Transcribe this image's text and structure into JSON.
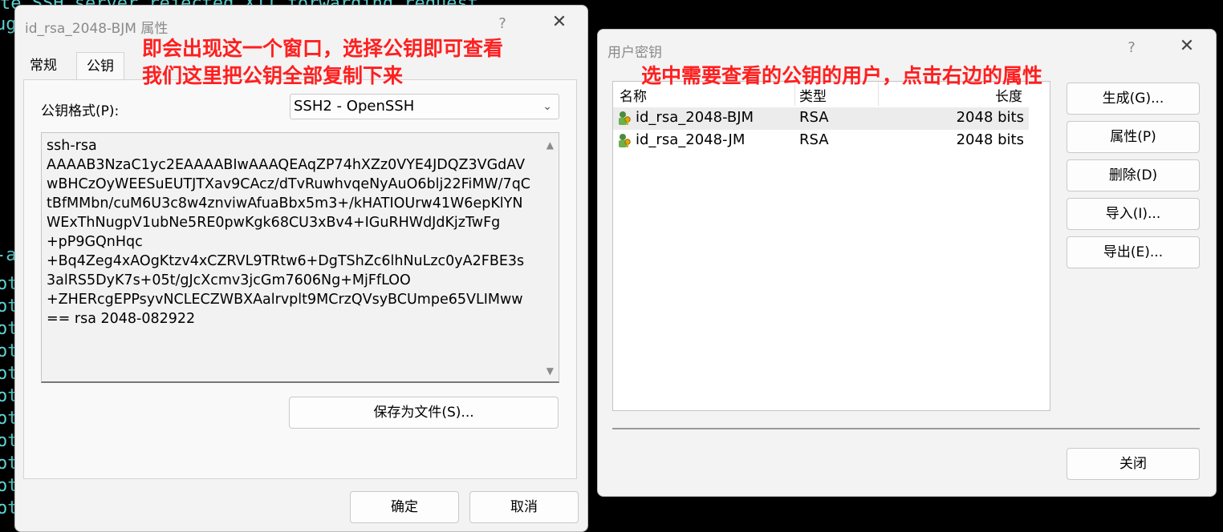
{
  "terminal": {
    "top_line": "te SSH server rejected X11 forwarding request.",
    "ug": "ug",
    "dash_a": "-a",
    "ot": "ot"
  },
  "props_dialog": {
    "title": "id_rsa_2048-BJM 属性",
    "help": "?",
    "close": "✕",
    "tabs": [
      "常规",
      "公钥"
    ],
    "format_label": "公钥格式(P):",
    "format_value": "SSH2 - OpenSSH",
    "key_text": "ssh-rsa\nAAAAB3NzaC1yc2EAAAABIwAAAQEAqZP74hXZz0VYE4JDQZ3VGdAVwBHCzOyWEESuEUTJTXav9CAcz/dTvRuwhvqeNyAuO6blj22FiMW/7qCtBfMMbn/cuM6U3c8w4znviwAfuaBbx5m3+/kHATIOUrw41W6epKlYNWExThNugpV1ubNe5RE0pwKgk68CU3xBv4+IGuRHWdJdKjzTwFg\n+pP9GQnHqc\n+Bq4Zeg4xAOgKtzv4xCZRVL9TRtw6+DgTShZc6lhNuLzc0yA2FBE3s3alRS5DyK7s+05t/gJcXcmv3jcGm7606Ng+MjFfLOO\n+ZHERcgEPPsyvNCLECZWBXAalrvplt9MCrzQVsyBCUmpe65VLIMww== rsa 2048-082922",
    "save_button": "保存为文件(S)...",
    "ok_button": "确定",
    "cancel_button": "取消",
    "annotation_line1": "即会出现这一个窗口，选择公钥即可查看",
    "annotation_line2": "我们这里把公钥全部复制下来"
  },
  "keys_dialog": {
    "title": "用户密钥",
    "help": "?",
    "close": "✕",
    "columns": [
      "名称",
      "类型",
      "长度"
    ],
    "rows": [
      {
        "name": "id_rsa_2048-BJM",
        "type": "RSA",
        "length": "2048 bits",
        "selected": true
      },
      {
        "name": "id_rsa_2048-JM",
        "type": "RSA",
        "length": "2048 bits",
        "selected": false
      }
    ],
    "buttons": {
      "generate": "生成(G)...",
      "properties": "属性(P)",
      "delete": "删除(D)",
      "import": "导入(I)...",
      "export": "导出(E)...",
      "close": "关闭"
    },
    "annotation": "选中需要查看的公钥的用户，点击右边的属性"
  },
  "colors": {
    "annotation": "#ff1f1f",
    "terminal_text": "#5fd7d7",
    "dialog_bg": "#f3f3f3"
  }
}
